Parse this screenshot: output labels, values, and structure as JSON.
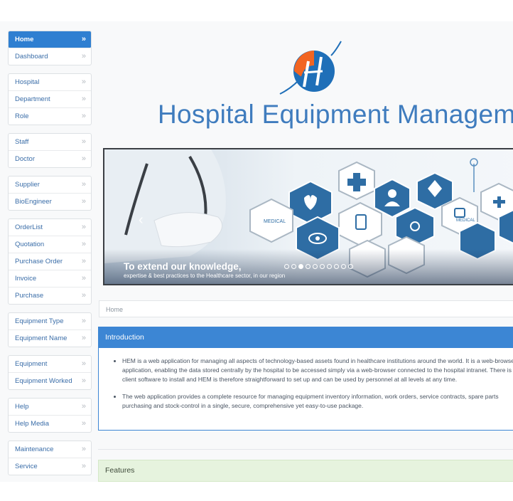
{
  "sidebar": {
    "groups": [
      [
        {
          "label": "Home"
        },
        {
          "label": "Dashboard"
        }
      ],
      [
        {
          "label": "Hospital"
        },
        {
          "label": "Department"
        },
        {
          "label": "Role"
        }
      ],
      [
        {
          "label": "Staff"
        },
        {
          "label": "Doctor"
        }
      ],
      [
        {
          "label": "Supplier"
        },
        {
          "label": "BioEngineer"
        }
      ],
      [
        {
          "label": "OrderList"
        },
        {
          "label": "Quotation"
        },
        {
          "label": "Purchase Order"
        },
        {
          "label": "Invoice"
        },
        {
          "label": "Purchase"
        }
      ],
      [
        {
          "label": "Equipment Type"
        },
        {
          "label": "Equipment Name"
        }
      ],
      [
        {
          "label": "Equipment"
        },
        {
          "label": "Equipment Worked"
        }
      ],
      [
        {
          "label": "Help"
        },
        {
          "label": "Help Media"
        }
      ],
      [
        {
          "label": "Maintenance"
        },
        {
          "label": "Service"
        }
      ]
    ],
    "chevron": "»"
  },
  "header": {
    "title": "Hospital Equipment Management"
  },
  "banner": {
    "caption_title": "To extend our knowledge,",
    "caption_sub": "expertise & best practices to the Healthcare sector, in our region",
    "hex_label_1": "MEDICAL",
    "hex_label_2": "MEDICAL"
  },
  "breadcrumb": {
    "current": "Home"
  },
  "intro": {
    "heading": "Introduction",
    "bullets": [
      "HEM is a web application for managing all aspects of technology-based assets found in healthcare institutions around the world. It is a web-browser application, enabling the data stored centrally by the hospital to be accessed simply via a web-browser connected to the hospital intranet. There is no client software to install and HEM is therefore straightforward to set up and can be used by personnel at all levels at any time.",
      "The web application provides a complete resource for managing equipment inventory information, work orders, service contracts, spare parts purchasing and stock-control in a single, secure, comprehensive yet easy-to-use package."
    ]
  },
  "features": {
    "heading": "Features"
  },
  "colors": {
    "accent": "#3c86d4",
    "logo_orange": "#f26522",
    "logo_blue": "#1f6fb8",
    "features_bg": "#e6f3de"
  }
}
